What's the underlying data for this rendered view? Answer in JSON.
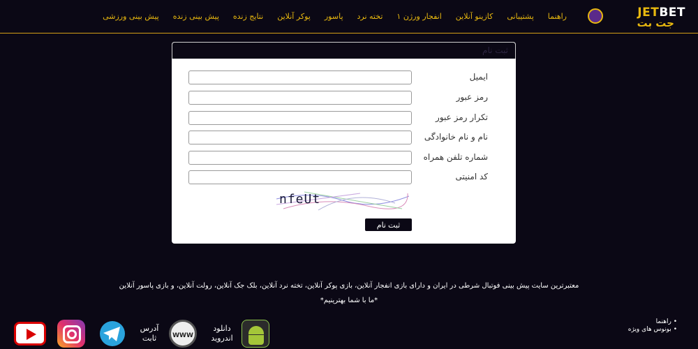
{
  "header": {
    "logo_latin_a": "JET",
    "logo_latin_b": "BET",
    "logo_persian": "جت بت",
    "nav": [
      "پیش بینی ورزشی",
      "پیش بینی زنده",
      "نتایج زنده",
      "پوکر آنلاین",
      "پاسور",
      "تخته نرد",
      "انفجار ورژن ۱",
      "کازینو آنلاین",
      "پشتیبانی",
      "راهنما"
    ]
  },
  "form": {
    "title": "ثبت نام",
    "fields": {
      "email": "ایمیل",
      "password": "رمز عبور",
      "password_confirm": "تکرار رمز عبور",
      "fullname": "نام و نام خانوادگی",
      "phone": "شماره تلفن همراه",
      "security_code": "کد امنیتی"
    },
    "captcha": "nfeUt",
    "submit": "ثبت نام"
  },
  "footer": {
    "description": "معتبرترین سایت پیش بینی فوتبال شرطی در ایران و دارای بازی انفجار آنلاین، بازی پوکر آنلاین، تخته نرد آنلاین، بلک جک آنلاین، رولت آنلاین، و بازی پاسور آنلاین",
    "tagline": "*ما با شما بهترینیم*",
    "links": [
      "راهنما",
      "بونوس های ویژه"
    ],
    "address_line1": "آدرس",
    "address_line2": "ثابت",
    "download_line1": "دانلود",
    "download_line2": "اندروید",
    "www_text": "WWW"
  },
  "colors": {
    "accent": "#e8b80f",
    "background": "#0b0815"
  }
}
